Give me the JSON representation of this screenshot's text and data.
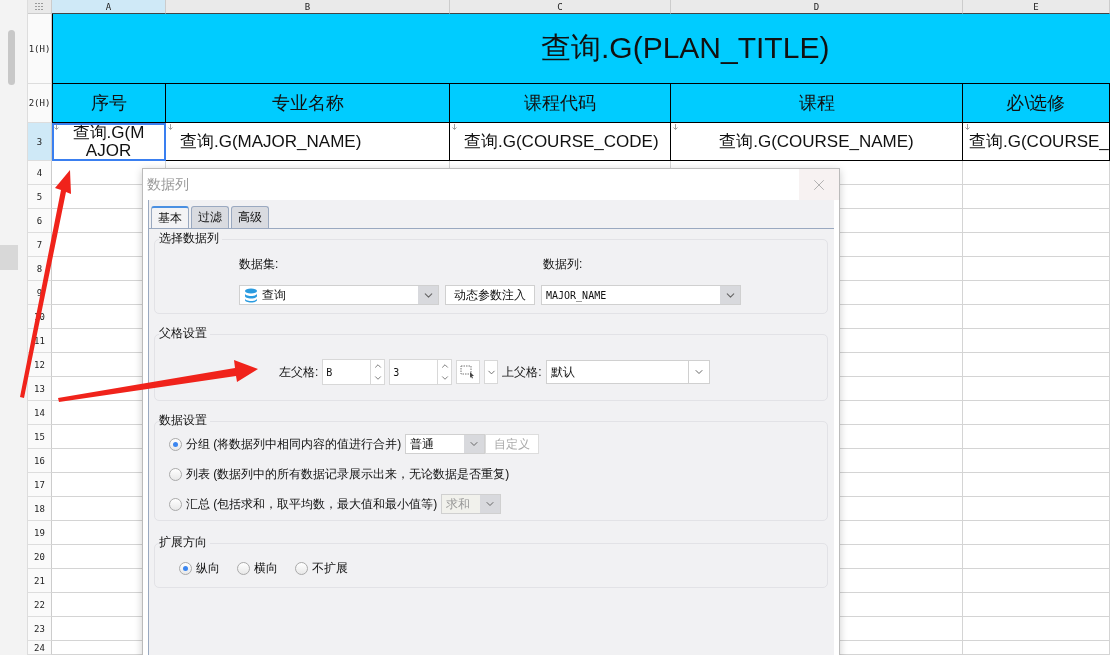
{
  "sheet": {
    "columns": [
      {
        "label": "A",
        "selected": true
      },
      {
        "label": "B",
        "selected": false
      },
      {
        "label": "C",
        "selected": false
      },
      {
        "label": "D",
        "selected": false
      },
      {
        "label": "E",
        "selected": false
      }
    ],
    "rows": [
      {
        "label": "1(H)",
        "selected": false
      },
      {
        "label": "2(H)",
        "selected": false
      },
      {
        "label": "3",
        "selected": true
      },
      {
        "label": "4",
        "selected": false
      },
      {
        "label": "5",
        "selected": false
      },
      {
        "label": "6",
        "selected": false
      },
      {
        "label": "7",
        "selected": false
      },
      {
        "label": "8",
        "selected": false
      },
      {
        "label": "9",
        "selected": false
      },
      {
        "label": "10",
        "selected": false
      },
      {
        "label": "11",
        "selected": false
      },
      {
        "label": "12",
        "selected": false
      },
      {
        "label": "13",
        "selected": false
      },
      {
        "label": "14",
        "selected": false
      },
      {
        "label": "15",
        "selected": false
      },
      {
        "label": "16",
        "selected": false
      },
      {
        "label": "17",
        "selected": false
      },
      {
        "label": "18",
        "selected": false
      },
      {
        "label": "19",
        "selected": false
      },
      {
        "label": "20",
        "selected": false
      },
      {
        "label": "21",
        "selected": false
      },
      {
        "label": "22",
        "selected": false
      },
      {
        "label": "23",
        "selected": false
      },
      {
        "label": "24",
        "selected": false
      }
    ],
    "title": "查询.G(PLAN_TITLE)",
    "headers": [
      "序号",
      "专业名称",
      "课程代码",
      "课程",
      "必\\选修"
    ],
    "cells": [
      {
        "text": "查询.G(MAJOR",
        "selected": true
      },
      {
        "text": "查询.G(MAJOR_NAME)",
        "selected": false
      },
      {
        "text": "查询.G(COURSE_CODE)",
        "selected": false
      },
      {
        "text": "查询.G(COURSE_NAME)",
        "selected": false
      },
      {
        "text": "查询.G(COURSE_",
        "selected": false
      }
    ]
  },
  "dialog": {
    "title": "数据列",
    "tabs": [
      {
        "label": "基本",
        "selected": true
      },
      {
        "label": "过滤",
        "selected": false
      },
      {
        "label": "高级",
        "selected": false
      }
    ],
    "select_column": {
      "title": "选择数据列",
      "dataset_label": "数据集:",
      "dataset_value": "查询",
      "inject_button": "动态参数注入",
      "column_label": "数据列:",
      "column_value": "MAJOR_NAME"
    },
    "parent": {
      "title": "父格设置",
      "left_label": "左父格:",
      "left_column": "B",
      "left_row": "3",
      "top_label": "上父格:",
      "top_value": "默认"
    },
    "data_settings": {
      "title": "数据设置",
      "options": [
        {
          "label": "分组 (将数据列中相同内容的值进行合并)",
          "selected": true,
          "select": {
            "value": "普通",
            "disabled": false
          },
          "button": {
            "label": "自定义",
            "disabled": true
          }
        },
        {
          "label": "列表 (数据列中的所有数据记录展示出来，无论数据是否重复)",
          "selected": false
        },
        {
          "label": "汇总 (包括求和，取平均数，最大值和最小值等)",
          "selected": false,
          "select": {
            "value": "求和",
            "disabled": true
          }
        }
      ]
    },
    "expand": {
      "title": "扩展方向",
      "options": [
        {
          "label": "纵向",
          "selected": true
        },
        {
          "label": "横向",
          "selected": false
        },
        {
          "label": "不扩展",
          "selected": false
        }
      ]
    }
  }
}
